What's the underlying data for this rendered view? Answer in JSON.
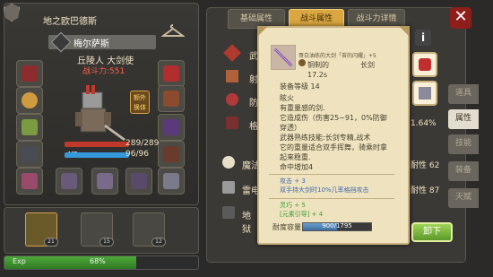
{
  "character": {
    "guild": "地之欧巴德斯",
    "name": "梅尔萨斯",
    "subtitle": "丘陵人 大剑使",
    "power": "战斗力:551",
    "hp_label": "HP",
    "mp_label": "MP",
    "hp": "289/289",
    "mp": "96/96",
    "hp_fraction": 1.0,
    "mp_fraction": 1.0,
    "extra_costume": "额外\n换体"
  },
  "party": [
    {
      "level": "21"
    },
    {
      "level": "15"
    },
    {
      "level": "12"
    }
  ],
  "exp": {
    "label": "Exp",
    "value": "68%",
    "fraction": 0.68
  },
  "tabs": [
    "基础属性",
    "战斗属性",
    "战斗力详情"
  ],
  "active_tab": "战斗属性",
  "stats_rows": [
    {
      "label": "武",
      "value": ""
    },
    {
      "label": "射",
      "value": ""
    },
    {
      "label": "防",
      "value": ""
    },
    {
      "label": "格",
      "value": "1.64%"
    },
    {
      "label": "魔法",
      "value": "耐性 62"
    },
    {
      "label": "雷电",
      "value": "耐性 87"
    },
    {
      "label": "地狱",
      "value": ""
    }
  ],
  "side_tabs": [
    "道具",
    "属性",
    "技能",
    "装备",
    "天赋"
  ],
  "active_side_tab": "属性",
  "tooltip": {
    "title": "哥白油练的大剑「苔的闪耀」+5",
    "kind": "铜制的",
    "type": "长剑",
    "time": "17.2s",
    "equip_level": "装备等级 14",
    "lines": [
      "眩火",
      "有重量感的剑.",
      "它造成伤（伤害25~91，0%防御",
      "穿透）",
      "武器熟练技能:长剑专精,战术",
      "它的重量适合双手挥舞，骑乘时拿",
      "起来稳重.",
      "命中增加4"
    ],
    "blue_lines": [
      "攻击 + 3",
      "双手持大剑时10%几率格挡攻击"
    ],
    "green_lines": [
      "灵巧 + 5",
      "[元素引导] + 4"
    ],
    "endurance_label": "耐度容量",
    "endurance_value": "900/1795",
    "endurance_fraction": 0.5,
    "unequip": "卸下"
  },
  "colors": {
    "accent_gold": "#d9a63f",
    "hp_red": "#c0392b",
    "mp_blue": "#3498db",
    "exp_green": "#4ea83a"
  }
}
